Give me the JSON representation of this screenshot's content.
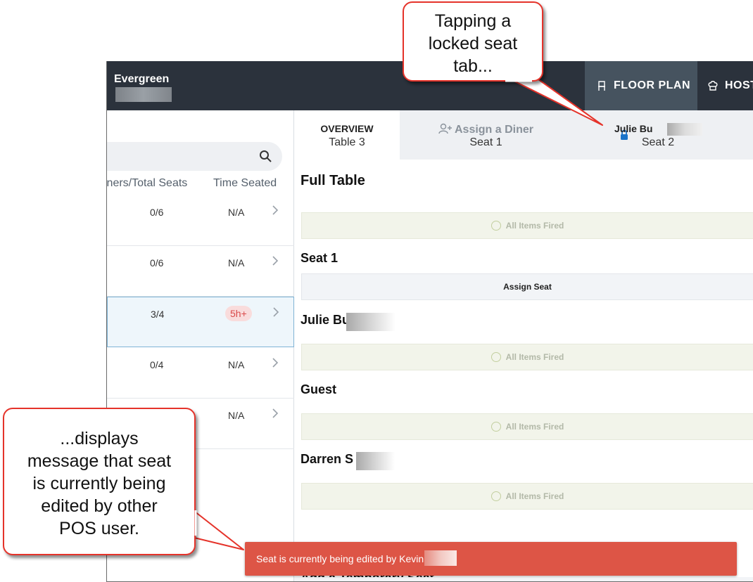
{
  "header": {
    "brand": "Evergreen",
    "nav": [
      {
        "label": "FLOOR PLAN",
        "icon": "chair-icon",
        "active": true
      },
      {
        "label": "HOST",
        "icon": "chef-hat-icon"
      }
    ]
  },
  "tables_panel": {
    "columns": {
      "diners_seats": "iners/Total Seats",
      "time_seated": "Time Seated"
    },
    "rows": [
      {
        "count": "0/6",
        "time": "N/A"
      },
      {
        "count": "0/6",
        "time": "N/A"
      },
      {
        "count": "3/4",
        "time": "5h+",
        "selected": true
      },
      {
        "count": "0/4",
        "time": "N/A"
      },
      {
        "count": "",
        "time": "N/A"
      }
    ]
  },
  "tabs": {
    "overview": {
      "title": "OVERVIEW",
      "sub": "Table 3"
    },
    "assign": {
      "title": "Assign a Diner",
      "sub": "Seat 1"
    },
    "seat2": {
      "title": "Julie Bu",
      "sub": "Seat 2",
      "locked": true
    }
  },
  "sections": {
    "full_table": "Full Table",
    "seat1": "Seat 1",
    "julie": "Julie Bu",
    "guest": "Guest",
    "darren": "Darren S",
    "add_temp": "Add a Temporary Seat"
  },
  "buttons": {
    "all_items_fired": "All Items Fired",
    "assign_seat": "Assign Seat"
  },
  "toast": {
    "message": "Seat is currently being edited by Kevin Ul"
  },
  "callouts": {
    "top": [
      "Tapping a",
      "locked seat",
      "tab..."
    ],
    "bottom": [
      "...displays",
      "message that seat",
      "is currently being",
      "edited by other",
      "POS user."
    ]
  },
  "colors": {
    "topbar": "#2b323c",
    "active_nav": "#46535f",
    "toast": "#dd5546",
    "callout_border": "#e5332a",
    "lock": "#1a73c9"
  }
}
